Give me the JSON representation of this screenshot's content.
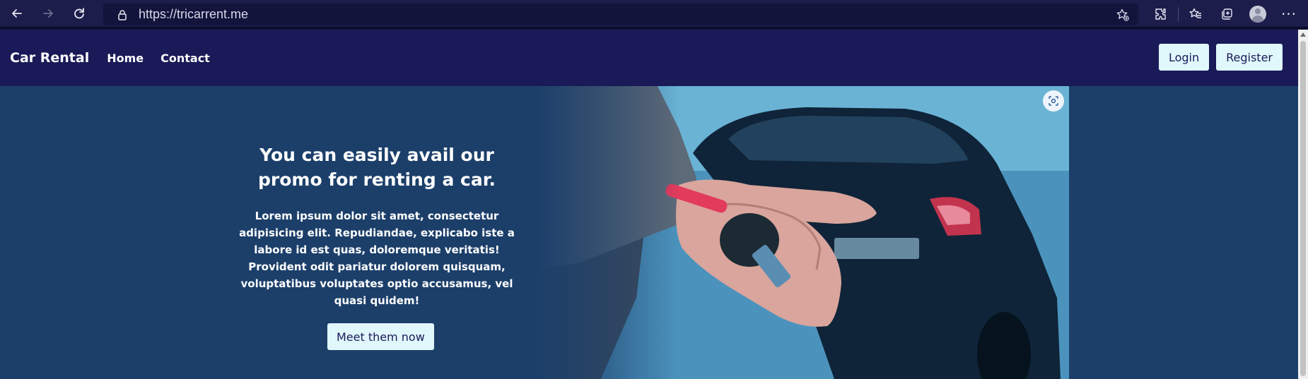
{
  "browser": {
    "url": "https://tricarrent.me",
    "icons": [
      "back-arrow-icon",
      "forward-arrow-icon",
      "refresh-icon",
      "lock-icon",
      "add-favorite-icon",
      "extensions-icon",
      "favorites-icon",
      "collections-icon",
      "profile-icon",
      "more-icon"
    ],
    "more_label": "···"
  },
  "nav": {
    "brand": "Car Rental",
    "links": [
      "Home",
      "Contact"
    ],
    "login_label": "Login",
    "register_label": "Register"
  },
  "hero": {
    "title": "You can easily avail our promo for renting a car.",
    "body": "Lorem ipsum dolor sit amet, consectetur adipisicing elit. Repudiandae, explicabo iste a labore id est quas, doloremque veritatis! Provident odit pariatur dolorem quisquam, voluptatibus voluptates optio accusamus, vel quasi quidem!",
    "cta_label": "Meet them now",
    "image_subject": "hand holding car keys in front of a car"
  },
  "colors": {
    "nav_bg": "#1a1a58",
    "hero_bg": "#1c3f6a",
    "button_bg": "#e0f7fb",
    "button_text": "#1a1a58"
  }
}
